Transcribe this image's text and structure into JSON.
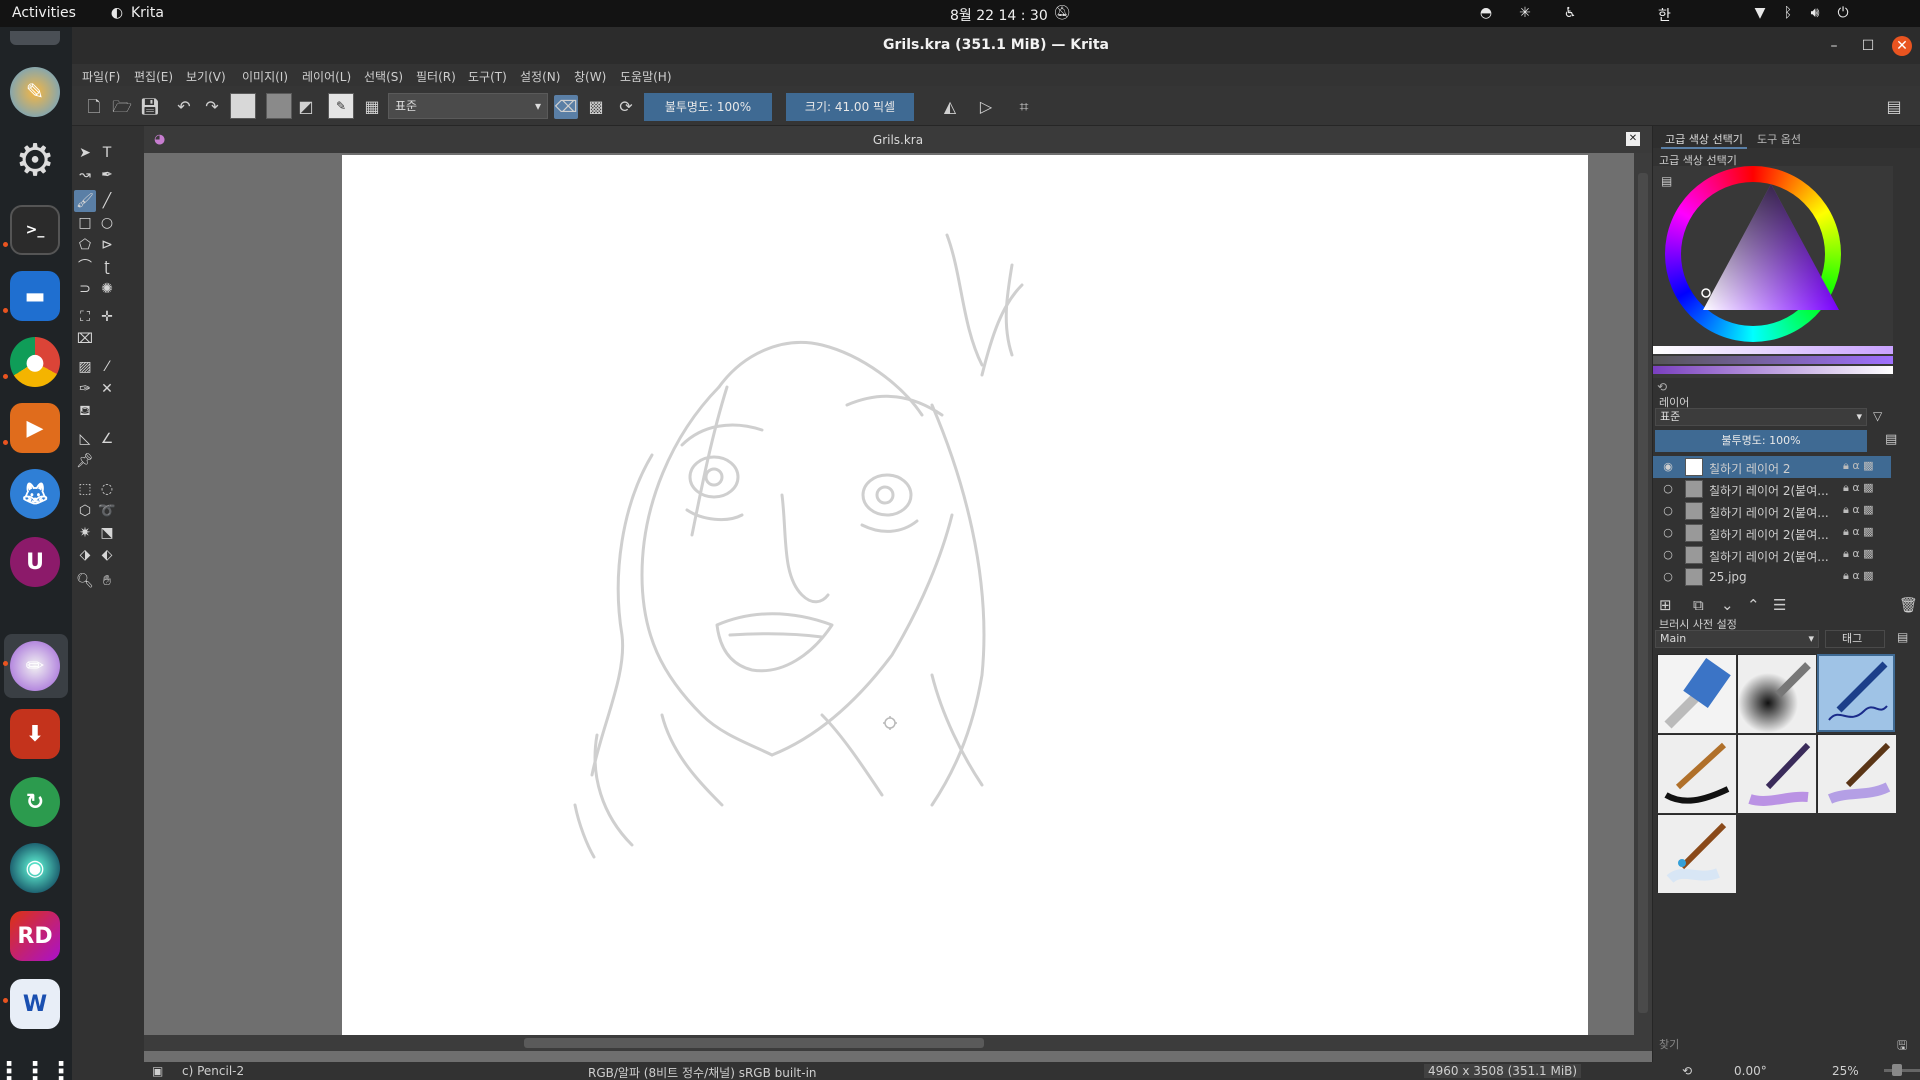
{
  "topbar": {
    "activities": "Activities",
    "app_name": "Krita",
    "clock": "8월 22  14 : 30",
    "input_method": "한"
  },
  "window": {
    "title": "Grils.kra (351.1 MiB)  — Krita"
  },
  "menu": [
    "파일(F)",
    "편집(E)",
    "보기(V)",
    "이미지(I)",
    "레이어(L)",
    "선택(S)",
    "필터(R)",
    "도구(T)",
    "설정(N)",
    "창(W)",
    "도움말(H)"
  ],
  "toolbar": {
    "blend_mode": "표준",
    "opacity": "불투명도: 100%",
    "size": "크기: 41.00 픽셀"
  },
  "document": {
    "tab_name": "Grils.kra"
  },
  "docker": {
    "tabs": [
      "고급 색상 선택기",
      "도구 옵션"
    ],
    "color_selector_title": "고급 색상 선택기",
    "layers_title": "레이어",
    "layer_blend": "표준",
    "layer_opacity": "불투명도: 100%",
    "layers": [
      {
        "name": "칠하기 레이어 2",
        "active": true
      },
      {
        "name": "칠하기 레이어 2(붙여...",
        "active": false
      },
      {
        "name": "칠하기 레이어 2(붙여...",
        "active": false
      },
      {
        "name": "칠하기 레이어 2(붙여...",
        "active": false
      },
      {
        "name": "칠하기 레이어 2(붙여...",
        "active": false
      },
      {
        "name": "25.jpg",
        "active": false
      }
    ],
    "brush_title": "브러시 사전 설정",
    "brush_tag": "Main",
    "brush_tag_button": "태그",
    "search_placeholder": "찾기"
  },
  "status": {
    "brush": "c) Pencil-2",
    "color_space": "RGB/알파 (8비트 정수/채널)  sRGB built-in",
    "dimensions": "4960 x 3508 (351.1 MiB)",
    "rotation": "0.00°",
    "zoom": "25%"
  },
  "colors": {
    "accent": "#3f6a93",
    "dock_bg": "#1f2326",
    "ubuntu_orange": "#e95420"
  }
}
